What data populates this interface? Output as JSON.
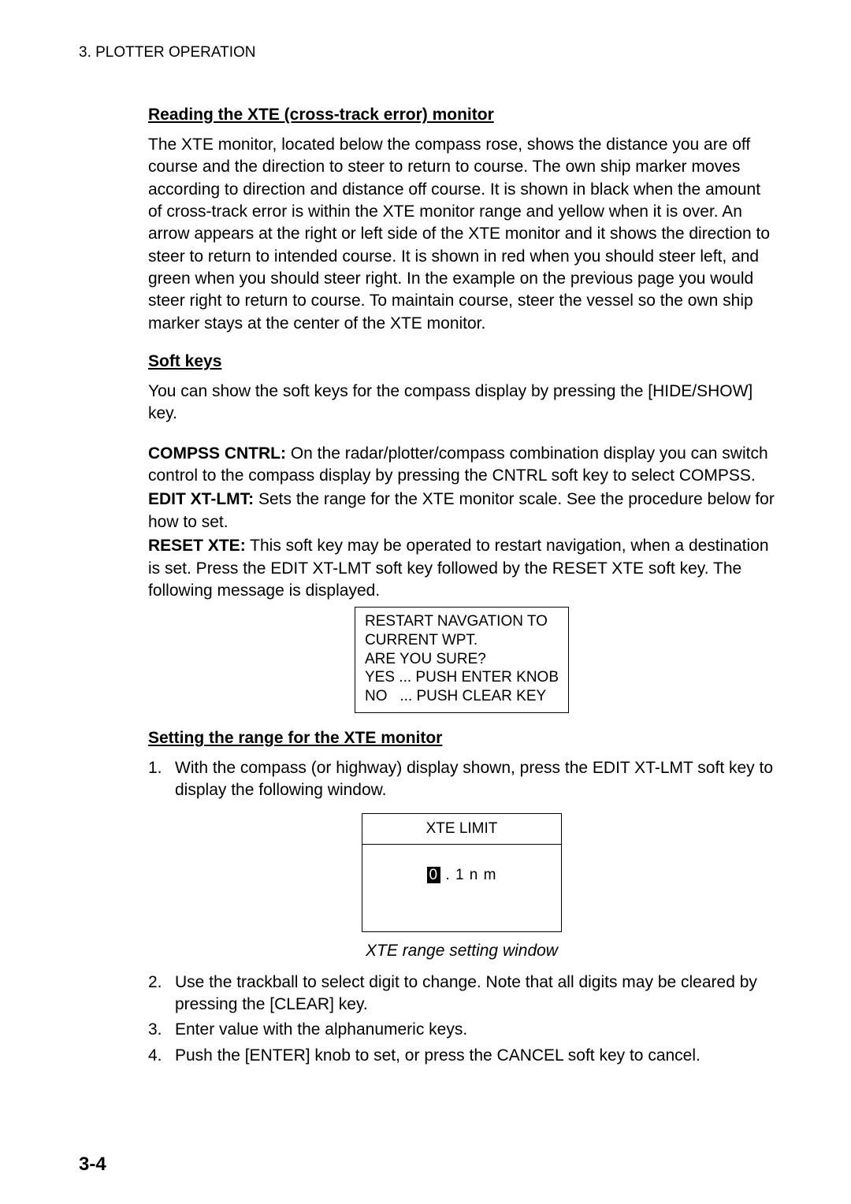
{
  "header": "3. PLOTTER OPERATION",
  "section1": {
    "heading": "Reading the XTE (cross-track error) monitor",
    "para": "The XTE monitor, located below the compass rose, shows the distance you are off course and the direction to steer to return to course. The own ship marker moves according to direction and distance off course. It is shown in black when the amount of cross-track error is within the XTE monitor range and yellow when it is over. An arrow appears at the right or left side of the XTE monitor and it shows the direction to steer to return to intended course. It is shown in red when you should steer left, and green when you should steer right. In the example on the previous page you would steer right to return to course. To maintain course, steer the vessel so the own ship marker stays at the center of the XTE monitor."
  },
  "section2": {
    "heading": "Soft keys",
    "para": "You can show the soft keys for the compass display by pressing the [HIDE/SHOW] key.",
    "defs": {
      "compss_label": "COMPSS CNTRL:",
      "compss_text": " On the radar/plotter/compass combination display you can switch control to the compass display by pressing the CNTRL soft key to select COMPSS.",
      "editxt_label": "EDIT XT-LMT:",
      "editxt_text": " Sets the range for the XTE monitor scale. See the procedure below for how to set.",
      "reset_label": "RESET XTE:",
      "reset_text": " This soft key may be operated to restart navigation, when a destination is set. Press the EDIT XT-LMT soft key followed by the RESET XTE soft key. The following message is displayed."
    }
  },
  "msgbox": "RESTART NAVGATION TO\nCURRENT WPT.\nARE YOU SURE?\nYES ... PUSH ENTER KNOB\nNO   ... PUSH CLEAR KEY",
  "section3": {
    "heading": "Setting the range for the XTE monitor",
    "step1": "With the compass (or highway) display shown, press the EDIT XT-LMT soft key to display the following window.",
    "xte_title": "XTE LIMIT",
    "xte_digit": "0",
    "xte_rest": " . 1 n m",
    "caption": "XTE range setting window",
    "step2": "Use the trackball to select digit to change. Note that all digits may be cleared by pressing the [CLEAR] key.",
    "step3": "Enter value with the alphanumeric keys.",
    "step4": "Push the [ENTER] knob to set, or press the CANCEL soft key to cancel."
  },
  "page_number": "3-4"
}
